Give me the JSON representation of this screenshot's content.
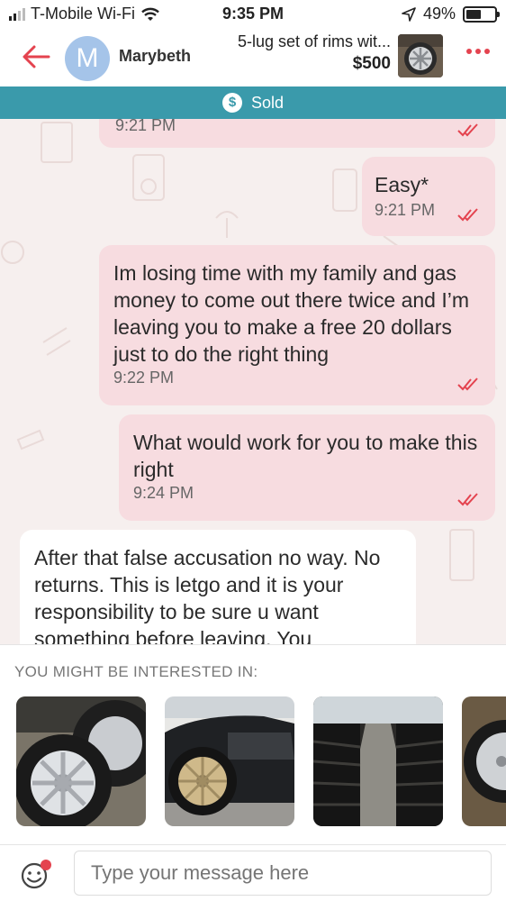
{
  "status_bar": {
    "carrier": "T-Mobile Wi-Fi",
    "time": "9:35 PM",
    "battery": "49%"
  },
  "header": {
    "avatar_letter": "M",
    "user_name": "Marybeth",
    "listing_title": "5-lug set of rims wit...",
    "listing_price": "$500",
    "icons": [
      "back-arrow-icon",
      "more-dots-icon"
    ],
    "accent_color": "#e4434f"
  },
  "sold_bar": {
    "label": "Sold",
    "color": "#3a9aab"
  },
  "messages": [
    {
      "text": "",
      "time": "9:21 PM",
      "direction": "out"
    },
    {
      "text": "Easy*",
      "time": "9:21 PM",
      "direction": "out"
    },
    {
      "text": "Im losing time with my family and gas money to come out there twice and I’m leaving you to make a free 20 dollars just to do the right thing",
      "time": "9:22 PM",
      "direction": "out"
    },
    {
      "text": "What would work for you to make this right",
      "time": "9:24 PM",
      "direction": "out"
    },
    {
      "text": "After that false accusation no way. No returns. This is letgo and it is your responsibility to be sure u want something before leaving. You",
      "direction": "in"
    }
  ],
  "suggestions": {
    "label": "YOU MIGHT BE INTERESTED IN:",
    "items": [
      "chrome-rims-photo",
      "gold-rim-car-photo",
      "tire-warehouse-photo",
      "rim-partial-photo"
    ]
  },
  "composer": {
    "placeholder": "Type your message here"
  }
}
